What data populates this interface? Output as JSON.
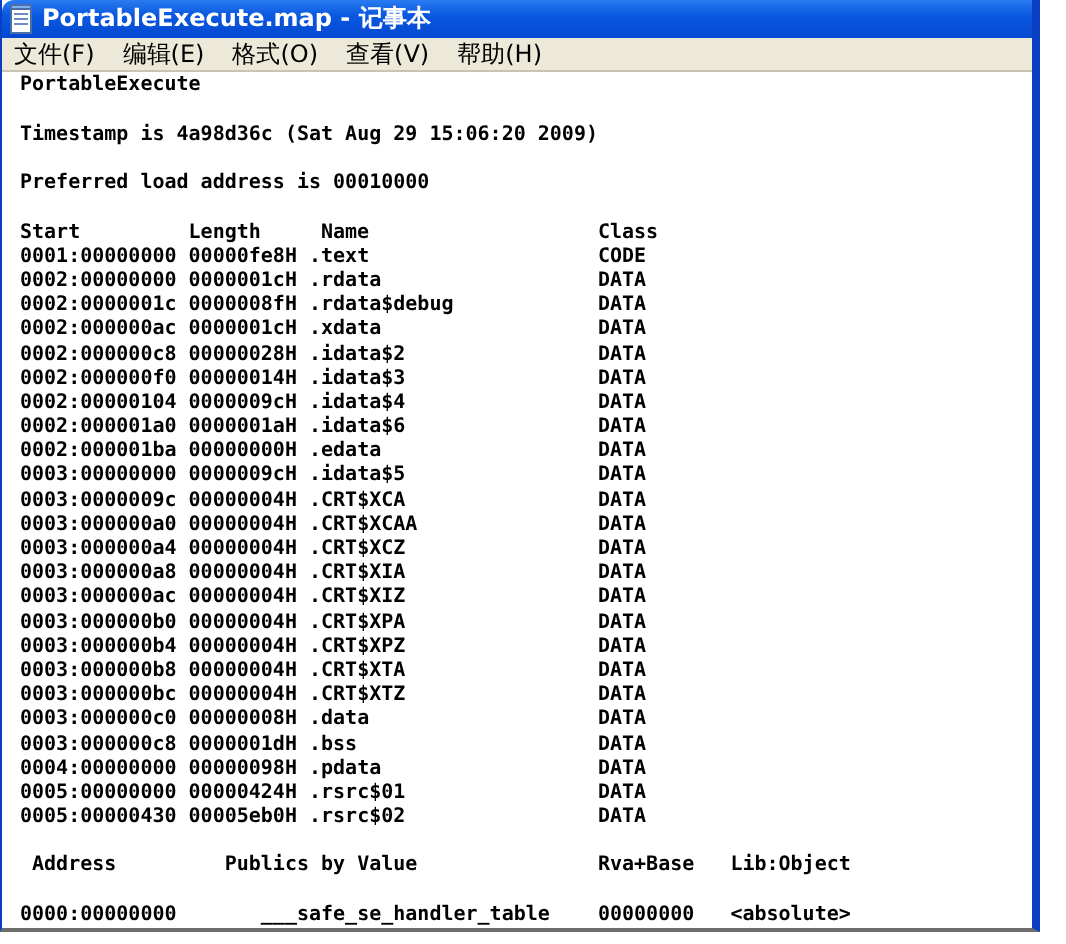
{
  "window": {
    "title": "PortableExecute.map - 记事本"
  },
  "menu": [
    "文件(F)",
    "编辑(E)",
    "格式(O)",
    "查看(V)",
    "帮助(H)"
  ],
  "document": {
    "module": "PortableExecute",
    "timestamp": "Timestamp is 4a98d36c (Sat Aug 29 15:06:20 2009)",
    "load_address": "Preferred load address is 00010000",
    "segments": {
      "columns": [
        "Start",
        "Length",
        "Name",
        "Class"
      ],
      "rows": [
        [
          "0001:00000000",
          "00000fe8H",
          ".text",
          "CODE"
        ],
        [
          "0002:00000000",
          "0000001cH",
          ".rdata",
          "DATA"
        ],
        [
          "0002:0000001c",
          "0000008fH",
          ".rdata$debug",
          "DATA"
        ],
        [
          "0002:000000ac",
          "0000001cH",
          ".xdata",
          "DATA"
        ],
        [
          "0002:000000c8",
          "00000028H",
          ".idata$2",
          "DATA"
        ],
        [
          "0002:000000f0",
          "00000014H",
          ".idata$3",
          "DATA"
        ],
        [
          "0002:00000104",
          "0000009cH",
          ".idata$4",
          "DATA"
        ],
        [
          "0002:000001a0",
          "0000001aH",
          ".idata$6",
          "DATA"
        ],
        [
          "0002:000001ba",
          "00000000H",
          ".edata",
          "DATA"
        ],
        [
          "0003:00000000",
          "0000009cH",
          ".idata$5",
          "DATA"
        ],
        [
          "0003:0000009c",
          "00000004H",
          ".CRT$XCA",
          "DATA"
        ],
        [
          "0003:000000a0",
          "00000004H",
          ".CRT$XCAA",
          "DATA"
        ],
        [
          "0003:000000a4",
          "00000004H",
          ".CRT$XCZ",
          "DATA"
        ],
        [
          "0003:000000a8",
          "00000004H",
          ".CRT$XIA",
          "DATA"
        ],
        [
          "0003:000000ac",
          "00000004H",
          ".CRT$XIZ",
          "DATA"
        ],
        [
          "0003:000000b0",
          "00000004H",
          ".CRT$XPA",
          "DATA"
        ],
        [
          "0003:000000b4",
          "00000004H",
          ".CRT$XPZ",
          "DATA"
        ],
        [
          "0003:000000b8",
          "00000004H",
          ".CRT$XTA",
          "DATA"
        ],
        [
          "0003:000000bc",
          "00000004H",
          ".CRT$XTZ",
          "DATA"
        ],
        [
          "0003:000000c0",
          "00000008H",
          ".data",
          "DATA"
        ],
        [
          "0003:000000c8",
          "0000001dH",
          ".bss",
          "DATA"
        ],
        [
          "0004:00000000",
          "00000098H",
          ".pdata",
          "DATA"
        ],
        [
          "0005:00000000",
          "00000424H",
          ".rsrc$01",
          "DATA"
        ],
        [
          "0005:00000430",
          "00005eb0H",
          ".rsrc$02",
          "DATA"
        ]
      ]
    },
    "publics": {
      "columns": [
        "Address",
        "Publics by Value",
        "Rva+Base",
        "Lib:Object"
      ],
      "rows": [
        [
          "0000:00000000",
          "___safe_se_handler_table",
          "00000000",
          "<absolute>"
        ]
      ]
    }
  }
}
